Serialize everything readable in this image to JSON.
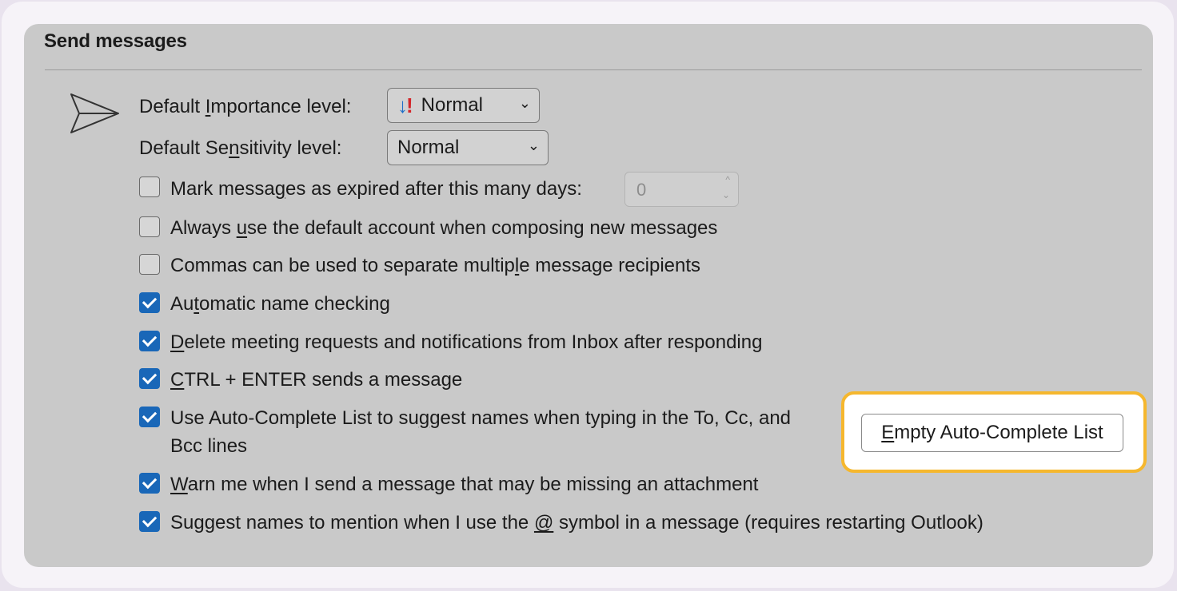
{
  "section": {
    "title": "Send messages"
  },
  "importance": {
    "label_pre": "Default ",
    "label_key": "I",
    "label_post": "mportance level:",
    "value": "Normal",
    "icon": "importance-normal-icon",
    "icon_down": "↓",
    "icon_bang": "!"
  },
  "sensitivity": {
    "label_pre": "Default Se",
    "label_key": "n",
    "label_post": "sitivity level:",
    "value": "Normal"
  },
  "chevron": "⌄",
  "expire": {
    "checked": false,
    "pre": "Mark messa",
    "key": "g",
    "post": "es as expired after this many days:",
    "days": "0",
    "spin_up": "^",
    "spin_down": "⌄"
  },
  "options": [
    {
      "checked": false,
      "pre": "Always ",
      "key": "u",
      "post": "se the default account when composing new messages"
    },
    {
      "checked": false,
      "pre": "Commas can be used to separate multip",
      "key": "l",
      "post": "e message recipients"
    },
    {
      "checked": true,
      "pre": "Au",
      "key": "t",
      "post": "omatic name checking"
    },
    {
      "checked": true,
      "pre": "",
      "key": "D",
      "post": "elete meeting requests and notifications from Inbox after responding"
    },
    {
      "checked": true,
      "pre": "",
      "key": "C",
      "post": "TRL + ENTER sends a message"
    },
    {
      "checked": true,
      "pre": "Use Auto-Complete List to su",
      "key": "g",
      "post": "gest names when typing in the To, Cc, and",
      "line2": "Bcc lines"
    },
    {
      "checked": true,
      "pre": "",
      "key": "W",
      "post": "arn me when I send a message that may be missing an attachment"
    },
    {
      "checked": true,
      "pre": "Suggest names to mention when I use the ",
      "key": "@",
      "post": " symbol in a message (requires restarting Outlook)"
    }
  ],
  "autocomplete_button": {
    "key": "E",
    "post": "mpty Auto-Complete List"
  },
  "colors": {
    "checkbox_on": "#1967b8",
    "highlight": "#f5b72e",
    "panel": "#c9c9c9"
  }
}
